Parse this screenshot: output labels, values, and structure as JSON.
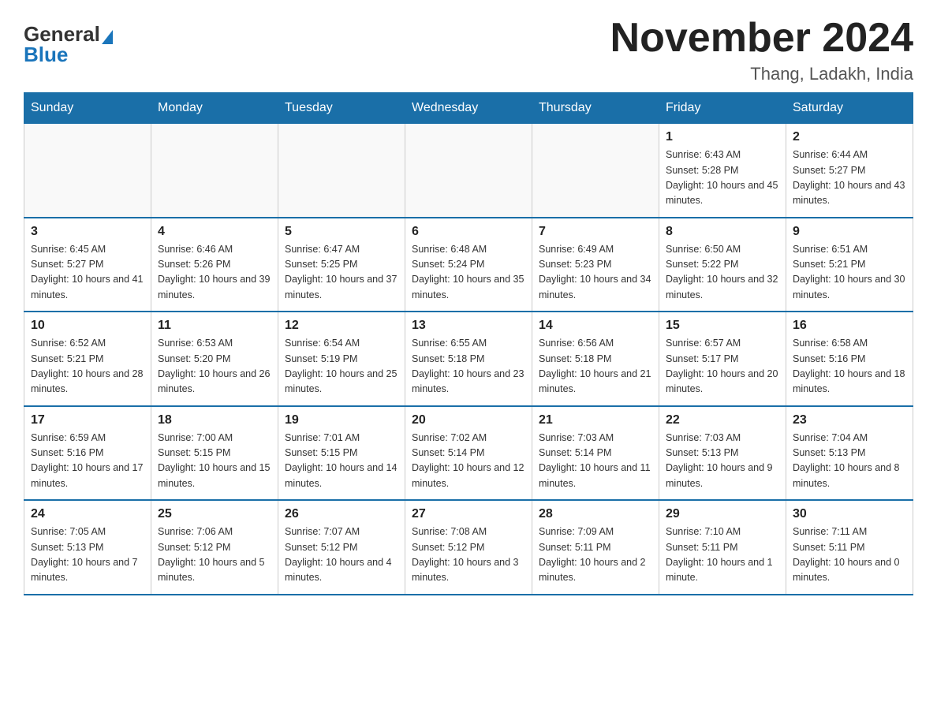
{
  "header": {
    "month_year": "November 2024",
    "location": "Thang, Ladakh, India",
    "logo_general": "General",
    "logo_blue": "Blue"
  },
  "days_of_week": [
    "Sunday",
    "Monday",
    "Tuesday",
    "Wednesday",
    "Thursday",
    "Friday",
    "Saturday"
  ],
  "weeks": [
    [
      {
        "day": "",
        "info": ""
      },
      {
        "day": "",
        "info": ""
      },
      {
        "day": "",
        "info": ""
      },
      {
        "day": "",
        "info": ""
      },
      {
        "day": "",
        "info": ""
      },
      {
        "day": "1",
        "info": "Sunrise: 6:43 AM\nSunset: 5:28 PM\nDaylight: 10 hours and 45 minutes."
      },
      {
        "day": "2",
        "info": "Sunrise: 6:44 AM\nSunset: 5:27 PM\nDaylight: 10 hours and 43 minutes."
      }
    ],
    [
      {
        "day": "3",
        "info": "Sunrise: 6:45 AM\nSunset: 5:27 PM\nDaylight: 10 hours and 41 minutes."
      },
      {
        "day": "4",
        "info": "Sunrise: 6:46 AM\nSunset: 5:26 PM\nDaylight: 10 hours and 39 minutes."
      },
      {
        "day": "5",
        "info": "Sunrise: 6:47 AM\nSunset: 5:25 PM\nDaylight: 10 hours and 37 minutes."
      },
      {
        "day": "6",
        "info": "Sunrise: 6:48 AM\nSunset: 5:24 PM\nDaylight: 10 hours and 35 minutes."
      },
      {
        "day": "7",
        "info": "Sunrise: 6:49 AM\nSunset: 5:23 PM\nDaylight: 10 hours and 34 minutes."
      },
      {
        "day": "8",
        "info": "Sunrise: 6:50 AM\nSunset: 5:22 PM\nDaylight: 10 hours and 32 minutes."
      },
      {
        "day": "9",
        "info": "Sunrise: 6:51 AM\nSunset: 5:21 PM\nDaylight: 10 hours and 30 minutes."
      }
    ],
    [
      {
        "day": "10",
        "info": "Sunrise: 6:52 AM\nSunset: 5:21 PM\nDaylight: 10 hours and 28 minutes."
      },
      {
        "day": "11",
        "info": "Sunrise: 6:53 AM\nSunset: 5:20 PM\nDaylight: 10 hours and 26 minutes."
      },
      {
        "day": "12",
        "info": "Sunrise: 6:54 AM\nSunset: 5:19 PM\nDaylight: 10 hours and 25 minutes."
      },
      {
        "day": "13",
        "info": "Sunrise: 6:55 AM\nSunset: 5:18 PM\nDaylight: 10 hours and 23 minutes."
      },
      {
        "day": "14",
        "info": "Sunrise: 6:56 AM\nSunset: 5:18 PM\nDaylight: 10 hours and 21 minutes."
      },
      {
        "day": "15",
        "info": "Sunrise: 6:57 AM\nSunset: 5:17 PM\nDaylight: 10 hours and 20 minutes."
      },
      {
        "day": "16",
        "info": "Sunrise: 6:58 AM\nSunset: 5:16 PM\nDaylight: 10 hours and 18 minutes."
      }
    ],
    [
      {
        "day": "17",
        "info": "Sunrise: 6:59 AM\nSunset: 5:16 PM\nDaylight: 10 hours and 17 minutes."
      },
      {
        "day": "18",
        "info": "Sunrise: 7:00 AM\nSunset: 5:15 PM\nDaylight: 10 hours and 15 minutes."
      },
      {
        "day": "19",
        "info": "Sunrise: 7:01 AM\nSunset: 5:15 PM\nDaylight: 10 hours and 14 minutes."
      },
      {
        "day": "20",
        "info": "Sunrise: 7:02 AM\nSunset: 5:14 PM\nDaylight: 10 hours and 12 minutes."
      },
      {
        "day": "21",
        "info": "Sunrise: 7:03 AM\nSunset: 5:14 PM\nDaylight: 10 hours and 11 minutes."
      },
      {
        "day": "22",
        "info": "Sunrise: 7:03 AM\nSunset: 5:13 PM\nDaylight: 10 hours and 9 minutes."
      },
      {
        "day": "23",
        "info": "Sunrise: 7:04 AM\nSunset: 5:13 PM\nDaylight: 10 hours and 8 minutes."
      }
    ],
    [
      {
        "day": "24",
        "info": "Sunrise: 7:05 AM\nSunset: 5:13 PM\nDaylight: 10 hours and 7 minutes."
      },
      {
        "day": "25",
        "info": "Sunrise: 7:06 AM\nSunset: 5:12 PM\nDaylight: 10 hours and 5 minutes."
      },
      {
        "day": "26",
        "info": "Sunrise: 7:07 AM\nSunset: 5:12 PM\nDaylight: 10 hours and 4 minutes."
      },
      {
        "day": "27",
        "info": "Sunrise: 7:08 AM\nSunset: 5:12 PM\nDaylight: 10 hours and 3 minutes."
      },
      {
        "day": "28",
        "info": "Sunrise: 7:09 AM\nSunset: 5:11 PM\nDaylight: 10 hours and 2 minutes."
      },
      {
        "day": "29",
        "info": "Sunrise: 7:10 AM\nSunset: 5:11 PM\nDaylight: 10 hours and 1 minute."
      },
      {
        "day": "30",
        "info": "Sunrise: 7:11 AM\nSunset: 5:11 PM\nDaylight: 10 hours and 0 minutes."
      }
    ]
  ]
}
